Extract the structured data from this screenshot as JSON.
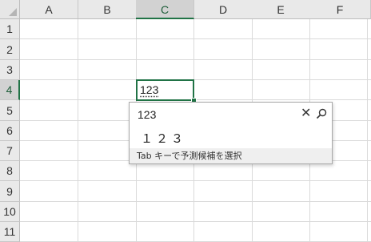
{
  "spreadsheet": {
    "columns": [
      "A",
      "B",
      "C",
      "D",
      "E",
      "F"
    ],
    "rows": [
      "1",
      "2",
      "3",
      "4",
      "5",
      "6",
      "7",
      "8",
      "9",
      "10",
      "11"
    ],
    "active_column": "C",
    "active_row": "4",
    "active_cell_value": "123"
  },
  "ime_popup": {
    "input_text": "123",
    "close_icon": "close-icon",
    "search_icon": "search-icon",
    "candidates": [
      "１２３"
    ],
    "hint": "Tab キーで予測候補を選択"
  },
  "colors": {
    "selection_accent": "#217346",
    "header_bg": "#e9e9e9",
    "grid_line": "#dadada"
  }
}
